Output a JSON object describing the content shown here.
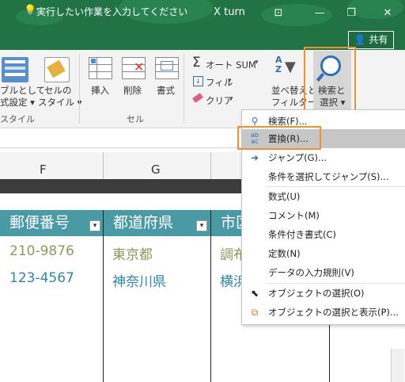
{
  "titlebar": {
    "title": "X turn",
    "buttons": [
      "⊡",
      "—",
      "❐",
      "✕"
    ]
  },
  "tellbar": {
    "text": "実行したい作業を入力してください",
    "share": "共有"
  },
  "ribbon": {
    "table_format": [
      "ブルとして",
      "式設定 ▾"
    ],
    "cell_style": [
      "セルの",
      "スタイル ▾"
    ],
    "style_group": "スタイル",
    "insert": "挿入",
    "delete": "削除",
    "format": "書式",
    "cells_group": "セル",
    "autosum": "オート SUM",
    "fill": "フィル",
    "clear": "クリア",
    "sort_filter": [
      "並べ替えと",
      "フィルター ▾"
    ],
    "find_select": [
      "検索と",
      "選択 ▾"
    ]
  },
  "columns": [
    "F",
    "G"
  ],
  "table": {
    "headers": [
      "郵便番号",
      "都道府県",
      "市区"
    ],
    "rows": [
      [
        "210-9876",
        "東京都",
        "調布"
      ],
      [
        "123-4567",
        "神奈川県",
        "横浜"
      ]
    ]
  },
  "menu": {
    "items": [
      {
        "label": "検索(F)...",
        "icon": "magnifier-icon"
      },
      {
        "label": "置換(R)...",
        "icon": "replace-icon"
      },
      {
        "label": "ジャンプ(G)...",
        "icon": "arrow-right-icon"
      },
      {
        "label": "条件を選択してジャンプ(S)..."
      },
      {
        "label": "数式(U)"
      },
      {
        "label": "コメント(M)"
      },
      {
        "label": "条件付き書式(C)"
      },
      {
        "label": "定数(N)"
      },
      {
        "label": "データの入力規則(V)"
      },
      {
        "label": "オブジェクトの選択(O)",
        "icon": "pointer-icon"
      },
      {
        "label": "オブジェクトの選択と表示(P)...",
        "icon": "selection-pane-icon"
      }
    ]
  },
  "colors": {
    "title_bg": "#217346",
    "header_bg": "#4a9aa5",
    "highlight": "#f0922e",
    "zip_color_1": "#8a9a5b",
    "zip_color_2": "#2e86ab"
  }
}
